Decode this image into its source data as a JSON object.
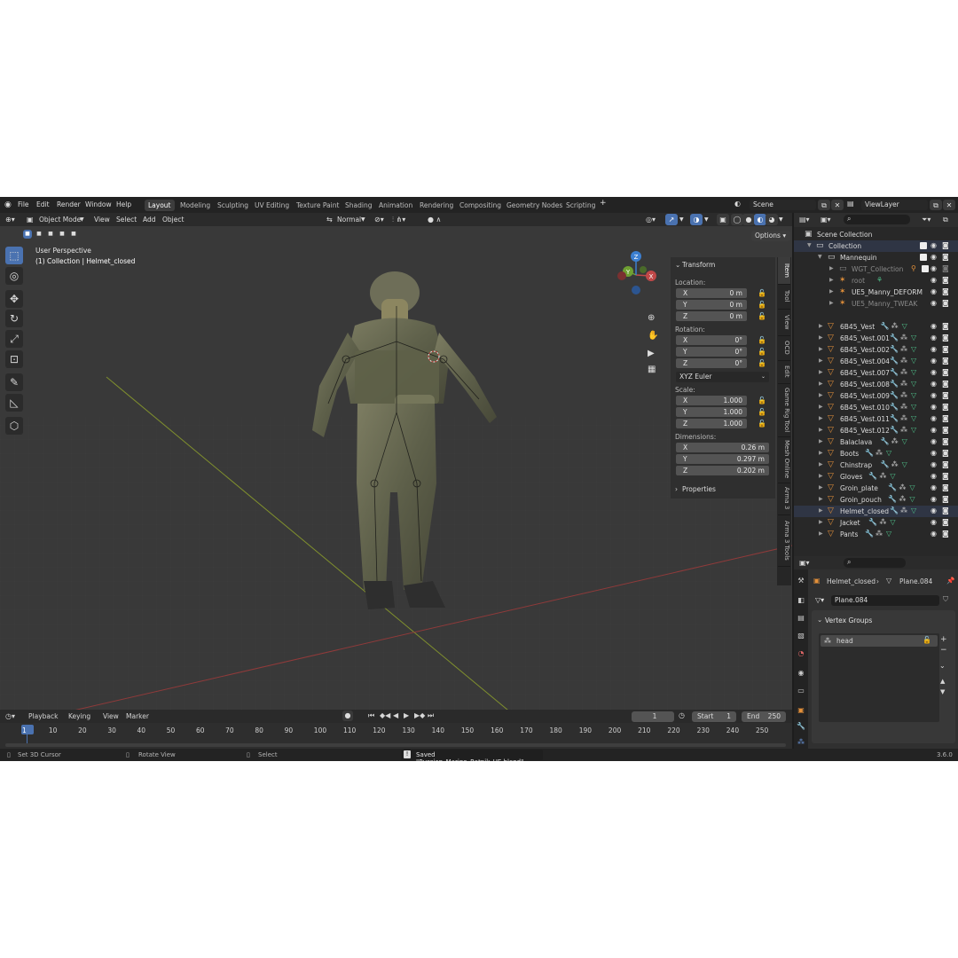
{
  "menu": [
    "File",
    "Edit",
    "Render",
    "Window",
    "Help"
  ],
  "workspaces": [
    "Layout",
    "Modeling",
    "Sculpting",
    "UV Editing",
    "Texture Paint",
    "Shading",
    "Animation",
    "Rendering",
    "Compositing",
    "Geometry Nodes",
    "Scripting"
  ],
  "add_workspace": "+",
  "scene": "Scene",
  "view_layer": "ViewLayer",
  "viewport": {
    "mode": "Object Mode",
    "menus": [
      "View",
      "Select",
      "Add",
      "Object"
    ],
    "orientation": "Normal",
    "options": "Options",
    "perspective": "User Perspective",
    "object_info": "(1) Collection | Helmet_closed"
  },
  "gizmo": {
    "x": "X",
    "y": "Y",
    "z": "Z"
  },
  "transform": {
    "header": "Transform",
    "location_label": "Location:",
    "rotation_label": "Rotation:",
    "scale_label": "Scale:",
    "dimensions_label": "Dimensions:",
    "location": [
      {
        "k": "X",
        "v": "0 m"
      },
      {
        "k": "Y",
        "v": "0 m"
      },
      {
        "k": "Z",
        "v": "0 m"
      }
    ],
    "rotation": [
      {
        "k": "X",
        "v": "0°"
      },
      {
        "k": "Y",
        "v": "0°"
      },
      {
        "k": "Z",
        "v": "0°"
      }
    ],
    "rotation_mode": "XYZ Euler",
    "scale": [
      {
        "k": "X",
        "v": "1.000"
      },
      {
        "k": "Y",
        "v": "1.000"
      },
      {
        "k": "Z",
        "v": "1.000"
      }
    ],
    "dimensions": [
      {
        "k": "X",
        "v": "0.26 m"
      },
      {
        "k": "Y",
        "v": "0.297 m"
      },
      {
        "k": "Z",
        "v": "0.202 m"
      }
    ],
    "properties_header": "Properties"
  },
  "side_tabs": [
    "Item",
    "Tool",
    "View",
    "OCD",
    "Edit",
    "Game Rig Tool",
    "Mesh Online",
    "Arma 3",
    "Arma 3 Tools"
  ],
  "outliner": {
    "root": "Scene Collection",
    "collection": "Collection",
    "mannequin": "Mannequin",
    "children": [
      "WGT_Collection",
      "root",
      "UE5_Manny_DEFORM",
      "UE5_Manny_TWEAK"
    ],
    "objects": [
      "6B45_Vest",
      "6B45_Vest.001",
      "6B45_Vest.002",
      "6B45_Vest.004",
      "6B45_Vest.007",
      "6B45_Vest.008",
      "6B45_Vest.009",
      "6B45_Vest.010",
      "6B45_Vest.011",
      "6B45_Vest.012",
      "Balaclava",
      "Boots",
      "Chinstrap",
      "Gloves",
      "Groin_plate",
      "Groin_pouch",
      "Helmet_closed",
      "Jacket",
      "Pants"
    ]
  },
  "properties": {
    "object": "Helmet_closed",
    "mesh": "Plane.084",
    "data_name": "Plane.084",
    "vertex_groups_header": "Vertex Groups",
    "vertex_groups": [
      "head"
    ]
  },
  "timeline": {
    "menus": [
      "Playback",
      "Keying",
      "View",
      "Marker"
    ],
    "current_frame": "1",
    "start_label": "Start",
    "start": "1",
    "end_label": "End",
    "end": "250",
    "ticks": [
      "1",
      "10",
      "20",
      "30",
      "40",
      "50",
      "60",
      "70",
      "80",
      "90",
      "100",
      "110",
      "120",
      "130",
      "140",
      "150",
      "160",
      "170",
      "180",
      "190",
      "200",
      "210",
      "220",
      "230",
      "240",
      "250"
    ]
  },
  "status": {
    "set_cursor": "Set 3D Cursor",
    "rotate": "Rotate View",
    "select": "Select",
    "saved": "Saved \"Russian_Marine_Ratnik_UE.blend\"",
    "version": "3.6.0"
  }
}
